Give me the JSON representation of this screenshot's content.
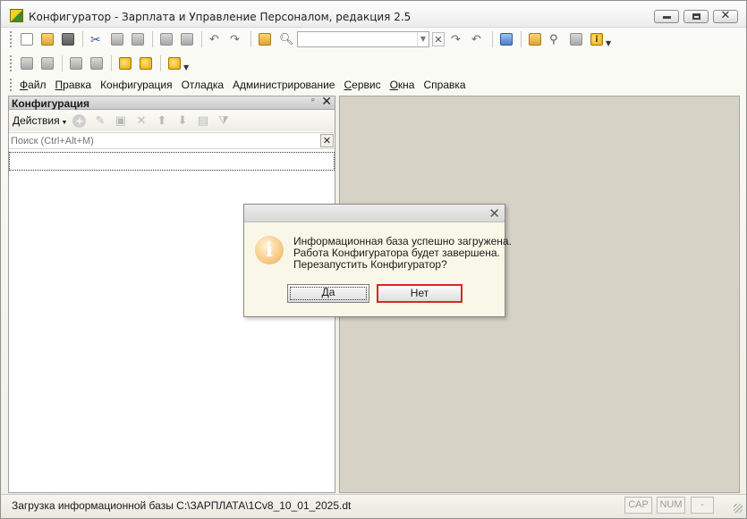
{
  "window": {
    "title": "Конфигуратор - Зарплата и Управление Персоналом, редакция 2.5",
    "minimize_label": "",
    "maximize_label": "",
    "close_label": "✕"
  },
  "toolbar": {
    "search_value": "",
    "icons": [
      "new-document-icon",
      "open-folder-icon",
      "save-icon",
      "cut-icon",
      "copy-icon",
      "paste-icon",
      "print-icon",
      "print-preview-icon",
      "undo-icon",
      "redo-icon",
      "find-in-files-icon",
      "search-icon",
      "find-next-icon",
      "find-previous-icon",
      "windows-icon",
      "debug-icon",
      "syntax-assistant-icon",
      "form-designer-icon",
      "info-icon"
    ]
  },
  "menu": {
    "items": [
      {
        "label": "Файл",
        "accel": "Ф",
        "rest": "айл"
      },
      {
        "label": "Правка",
        "accel": "П",
        "rest": "равка"
      },
      {
        "label": "Конфигурация",
        "accel": "",
        "rest": "Конфигурация"
      },
      {
        "label": "Отладка",
        "accel": "",
        "rest": "Отладка"
      },
      {
        "label": "Администрирование",
        "accel": "",
        "rest": "Администрирование"
      },
      {
        "label": "Сервис",
        "accel": "С",
        "rest": "ервис"
      },
      {
        "label": "Окна",
        "accel": "О",
        "rest": "кна"
      },
      {
        "label": "Справка",
        "accel": "",
        "rest": "Справка"
      }
    ]
  },
  "panel": {
    "title": "Конфигурация",
    "pin_label": "ᵖ",
    "close_label": "✕",
    "actions_label": "Действия",
    "search_placeholder": "Поиск (Ctrl+Alt+M)",
    "search_value": ""
  },
  "dialog": {
    "close_label": "✕",
    "icon_glyph": "i",
    "message_lines": [
      "Информационная база успешно загружена.",
      "Работа Конфигуратора будет завершена.",
      "Перезапустить Конфигуратор?"
    ],
    "yes_label": "Да",
    "no_label": "Нет",
    "highlight_color": "#d62828"
  },
  "statusbar": {
    "text": "Загрузка информационной базы C:\\ЗАРПЛАТА\\1Cv8_10_01_2025.dt",
    "cap_label": "CAP",
    "num_label": "NUM",
    "lang_label": "-"
  }
}
